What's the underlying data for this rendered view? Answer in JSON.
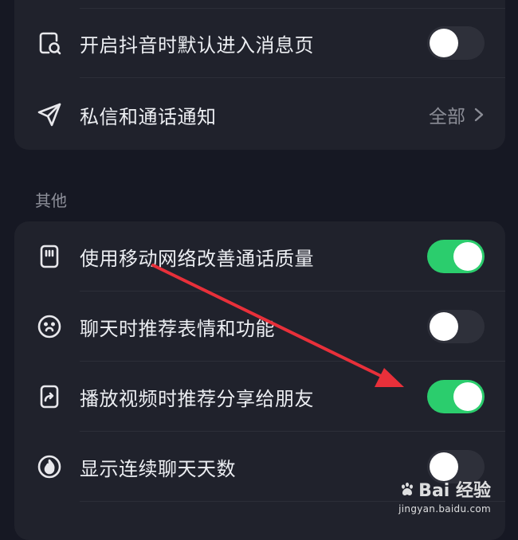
{
  "notifications_group": {
    "rows": [
      {
        "label": "开启抖音时默认进入消息页",
        "toggle_on": false
      },
      {
        "label": "私信和通话通知",
        "value": "全部"
      }
    ]
  },
  "others_group": {
    "header": "其他",
    "rows": [
      {
        "label": "使用移动网络改善通话质量",
        "toggle_on": true
      },
      {
        "label": "聊天时推荐表情和功能",
        "toggle_on": false
      },
      {
        "label": "播放视频时推荐分享给朋友",
        "toggle_on": true
      },
      {
        "label": "显示连续聊天天数",
        "toggle_on": false
      }
    ]
  },
  "colors": {
    "background": "#161823",
    "card": "#20222c",
    "toggle_on": "#2bcd6d",
    "toggle_off": "#2e303a",
    "annotation_arrow": "#e8303a"
  },
  "icons": {
    "open_message_page": "message-page-icon",
    "dm_notification": "paper-plane-icon",
    "mobile_network": "sim-card-icon",
    "recommend_emoji": "smiley-face-icon",
    "share_to_friends": "share-file-icon",
    "chat_streak": "flame-icon"
  },
  "watermark": {
    "brand": "Bai 经验",
    "url": "jingyan.baidu.com"
  }
}
